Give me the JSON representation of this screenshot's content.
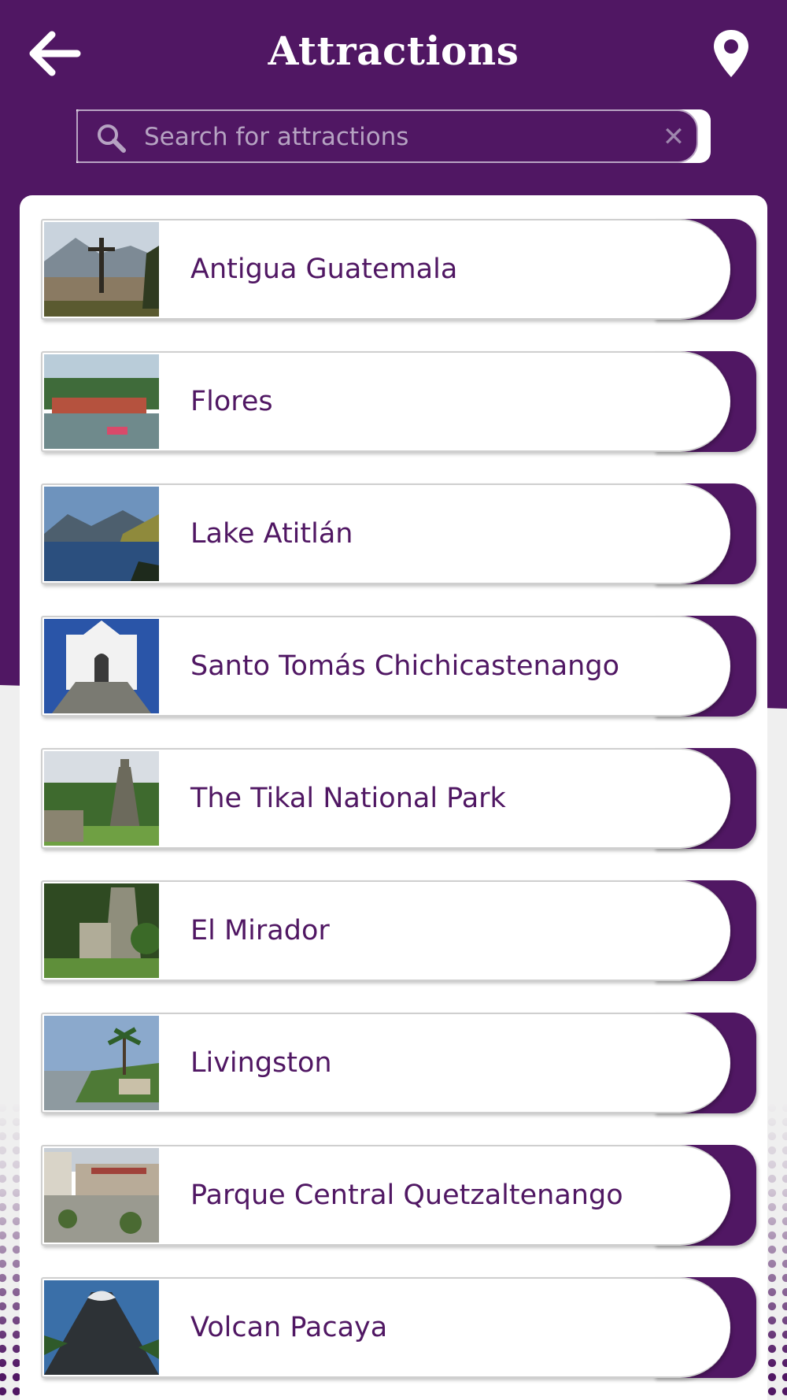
{
  "header": {
    "title": "Attractions",
    "back_icon": "arrow-left-icon",
    "map_icon": "map-pin-icon"
  },
  "search": {
    "placeholder": "Search for attractions",
    "value": "",
    "icon": "search-icon",
    "clear_icon": "close-icon"
  },
  "colors": {
    "brand_purple": "#501763",
    "background": "#efefef",
    "card": "#ffffff"
  },
  "attractions": [
    {
      "name": "Antigua Guatemala",
      "thumb_icon": "antigua-photo"
    },
    {
      "name": "Flores",
      "thumb_icon": "flores-photo"
    },
    {
      "name": "Lake Atitlán",
      "thumb_icon": "lake-photo"
    },
    {
      "name": "Santo Tomás Chichicastenango",
      "thumb_icon": "church-photo"
    },
    {
      "name": "The Tikal National Park",
      "thumb_icon": "tikal-photo"
    },
    {
      "name": "El Mirador",
      "thumb_icon": "mirador-photo"
    },
    {
      "name": "Livingston",
      "thumb_icon": "livingston-photo"
    },
    {
      "name": "Parque Central Quetzaltenango",
      "thumb_icon": "plaza-photo"
    },
    {
      "name": "Volcan Pacaya",
      "thumb_icon": "volcano-photo"
    }
  ]
}
